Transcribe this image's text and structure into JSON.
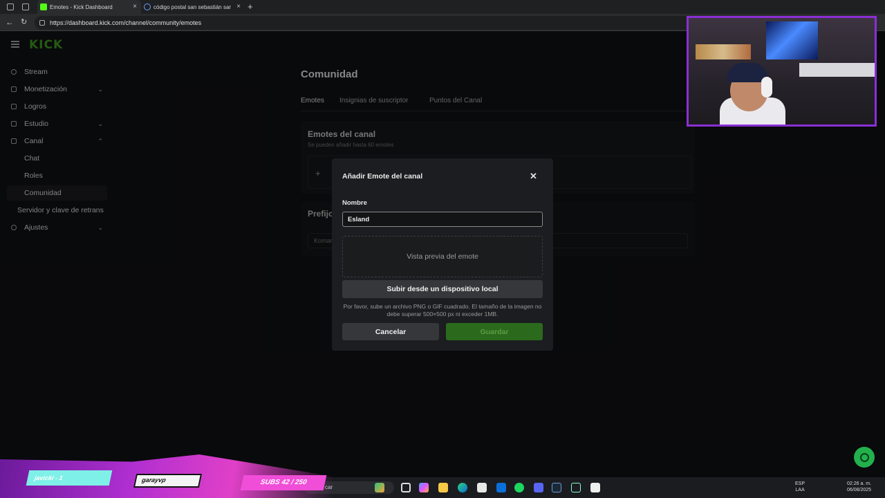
{
  "browser": {
    "tabs": [
      {
        "label": "Emotes - Kick Dashboard",
        "close": "×"
      },
      {
        "label": "código postal san sebastián san ...",
        "close": "×"
      }
    ],
    "new_tab": "+",
    "url": "https://dashboard.kick.com/channel/community/emotes"
  },
  "sidebar": {
    "logo": "KICK",
    "items": [
      {
        "label": "Stream",
        "icon": "broadcast-icon"
      },
      {
        "label": "Monetización",
        "icon": "money-icon",
        "chevron": "⌄"
      },
      {
        "label": "Logros",
        "icon": "trophy-icon"
      },
      {
        "label": "Estudio",
        "icon": "studio-icon",
        "chevron": "⌄"
      },
      {
        "label": "Canal",
        "icon": "channel-icon",
        "chevron": "⌃"
      },
      {
        "label": "Chat"
      },
      {
        "label": "Roles"
      },
      {
        "label": "Comunidad"
      },
      {
        "label": "Servidor y clave de retrans"
      },
      {
        "label": "Ajustes",
        "icon": "gear-icon",
        "chevron": "⌄"
      }
    ]
  },
  "main": {
    "title": "Comunidad",
    "tabs": [
      "Emotes",
      "Insignias de suscriptor",
      "Puntos del Canal"
    ],
    "emotes_section": {
      "title": "Emotes del canal",
      "subtitle": "Se pueden añadir hasta 60 emotes",
      "add": "+"
    },
    "prefix_section": {
      "title": "Prefijo",
      "input_text": "Komar"
    }
  },
  "modal": {
    "title": "Añadir Emote del canal",
    "close": "✕",
    "name_label": "Nombre",
    "name_value": "Esland",
    "preview_text": "Vista previa del emote",
    "upload_label": "Subir desde un dispositivo local",
    "hint": "Por favor, sube un archivo PNG o GIF cuadrado. El tamaño de la imagen no debe superar 500×500 px ni exceder 1MB.",
    "cancel_label": "Cancelar",
    "save_label": "Guardar"
  },
  "stream_overlay": {
    "user1": "javicki - 1",
    "user2": "garayvp",
    "subs": "SUBS 42 / 250"
  },
  "taskbar": {
    "search_text": "car",
    "lang": [
      "ESP",
      "LAA"
    ],
    "clock": [
      "02:26 a. m.",
      "06/08/2025"
    ]
  },
  "colors": {
    "accent_green": "#2b6a1c",
    "kick_green": "#3a8a1f",
    "webcam_border": "#8b2fd6"
  }
}
